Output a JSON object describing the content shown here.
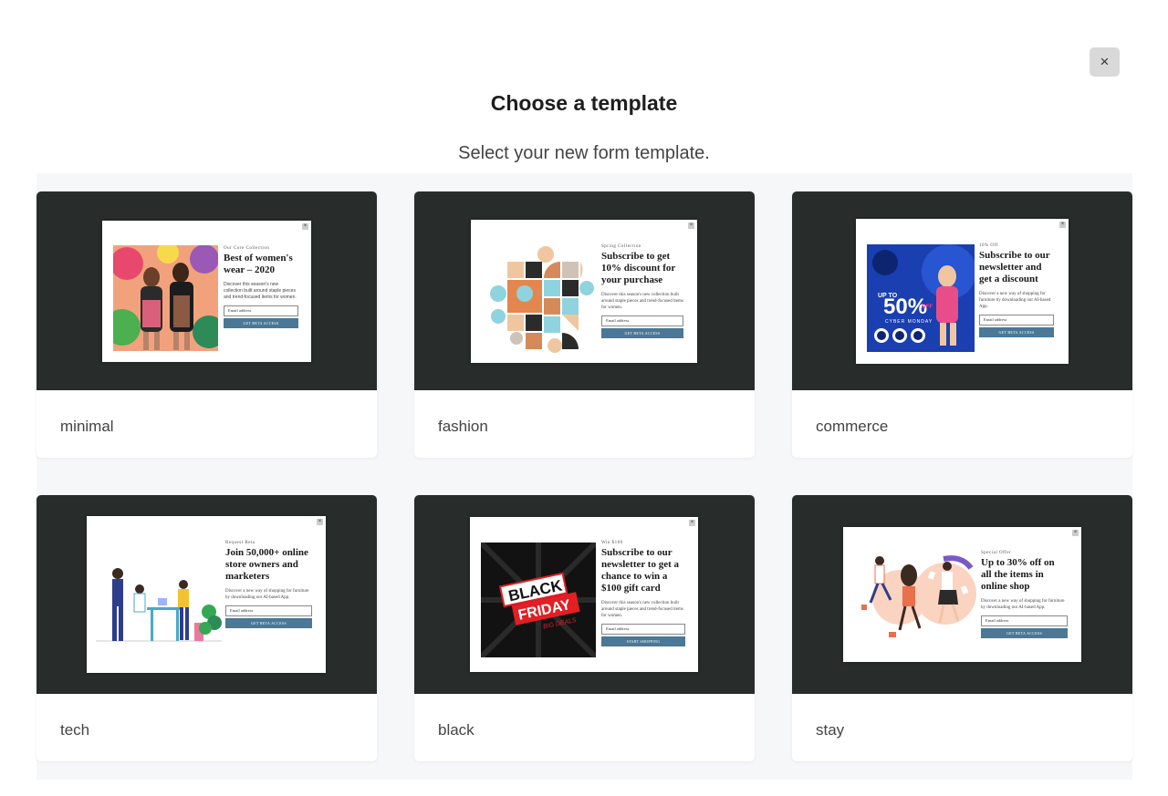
{
  "dialog": {
    "title": "Choose a template",
    "subtitle": "Select your new form template.",
    "close_label": "×"
  },
  "templates": [
    {
      "label": "minimal",
      "eyebrow": "Our Core Collection",
      "headline": "Best of women's wear – 2020",
      "description": "Discover this season's new collection built around staple pieces and trend-focused items for women.",
      "email_placeholder": "Email address",
      "cta": "GET BETA ACCESS"
    },
    {
      "label": "fashion",
      "eyebrow": "Spring Collection",
      "headline": "Subscribe to get 10% discount for your purchase",
      "description": "Discover this season's new collection built around staple pieces and trend-focused items for women.",
      "email_placeholder": "Email address",
      "cta": "GET BETA ACCESS"
    },
    {
      "label": "commerce",
      "eyebrow": "10% Off",
      "headline": "Subscribe to our newsletter and get a discount",
      "description": "Discover a new way of shopping for furniture by downloading our AI-based App.",
      "email_placeholder": "Email address",
      "cta": "GET BETA ACCESS",
      "promo": "50%",
      "promo_prefix": "UP TO",
      "promo_suffix": "OFF",
      "promo_caption": "CYBER MONDAY"
    },
    {
      "label": "tech",
      "eyebrow": "Request Beta",
      "headline": "Join 50,000+ online store owners and marketers",
      "description": "Discover a new way of shopping for furniture by downloading our AI-based App.",
      "email_placeholder": "Email address",
      "cta": "GET BETA ACCESS"
    },
    {
      "label": "black",
      "eyebrow": "Win $100",
      "headline": "Subscribe to our newsletter to get a chance to win a $100 gift card",
      "description": "Discover this season's new collection built around staple pieces and trend-focused items for women.",
      "email_placeholder": "Email address",
      "cta": "START SHOPPING",
      "promo_line1": "BLACK",
      "promo_line2": "FRIDAY",
      "promo_line3": "BIG DEALS"
    },
    {
      "label": "stay",
      "eyebrow": "Special Offer",
      "headline": "Up to 30% off on all the items in online shop",
      "description": "Discover a new way of shopping for furniture by downloading our AI-based App.",
      "email_placeholder": "Email address",
      "cta": "GET BETA ACCESS"
    }
  ],
  "colors": {
    "preview_bg": "#282c2b",
    "cta_bg": "#4a7896",
    "grid_bg": "#f6f7f8"
  }
}
